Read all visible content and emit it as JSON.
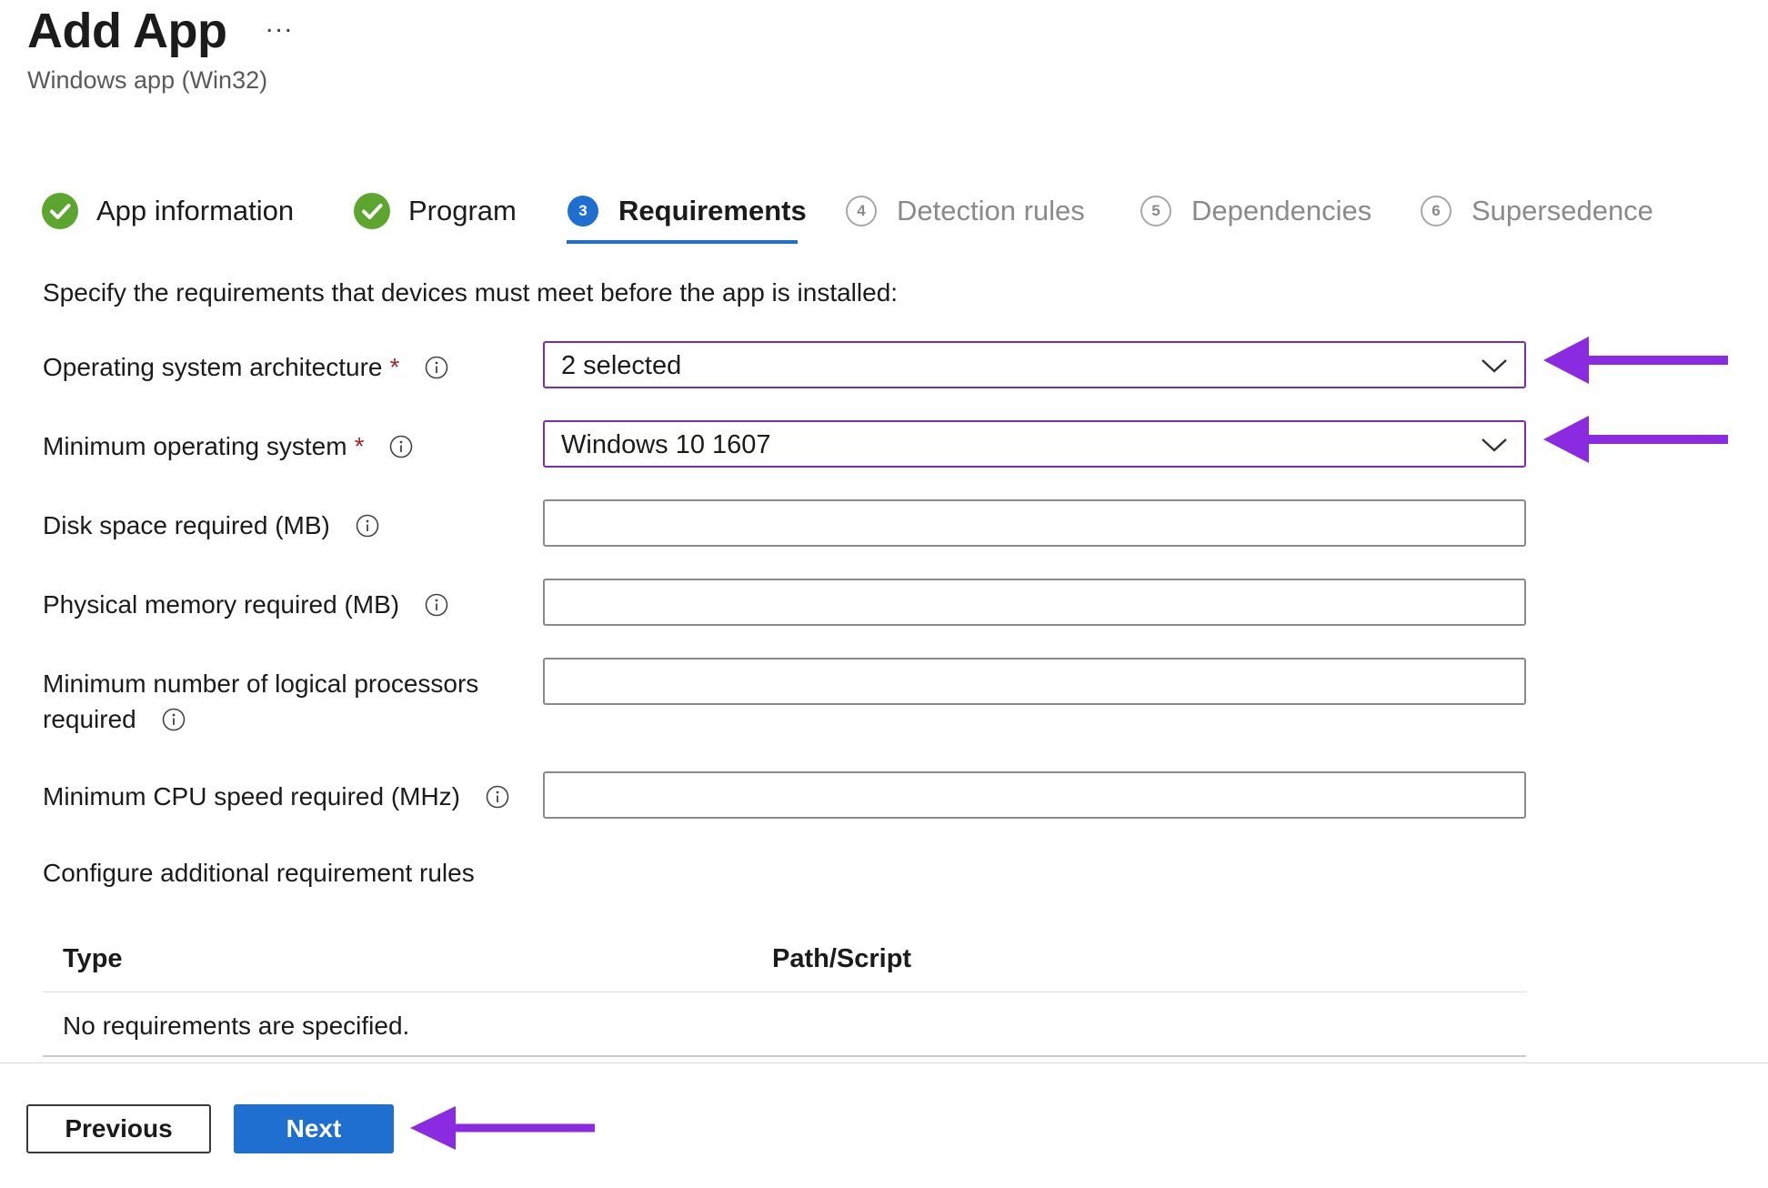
{
  "header": {
    "title": "Add App",
    "more_label": "...",
    "subtitle": "Windows app (Win32)"
  },
  "steps": [
    {
      "label": "App information",
      "state": "complete",
      "icon": "check-circle-icon"
    },
    {
      "label": "Program",
      "state": "complete",
      "icon": "check-circle-icon"
    },
    {
      "label": "Requirements",
      "state": "active",
      "number": "3"
    },
    {
      "label": "Detection rules",
      "state": "pending",
      "number": "4"
    },
    {
      "label": "Dependencies",
      "state": "pending",
      "number": "5"
    },
    {
      "label": "Supersedence",
      "state": "pending",
      "number": "6"
    }
  ],
  "instructions": "Specify the requirements that devices must meet before the app is installed:",
  "form": {
    "os_architecture": {
      "label": "Operating system architecture",
      "required_mark": "*",
      "value": "2 selected"
    },
    "min_os": {
      "label": "Minimum operating system",
      "required_mark": "*",
      "value": "Windows 10 1607"
    },
    "disk_space": {
      "label": "Disk space required (MB)",
      "value": ""
    },
    "physical_memory": {
      "label": "Physical memory required (MB)",
      "value": ""
    },
    "logical_processors": {
      "label_line1": "Minimum number of logical processors",
      "label_line2": "required",
      "value": ""
    },
    "cpu_speed": {
      "label": "Minimum CPU speed required (MHz)",
      "value": ""
    }
  },
  "additional_rules": {
    "title": "Configure additional requirement rules",
    "columns": [
      "Type",
      "Path/Script"
    ],
    "empty_message": "No requirements are specified."
  },
  "footer": {
    "previous_label": "Previous",
    "next_label": "Next"
  },
  "colors": {
    "accent": "#1e6fd0",
    "success": "#5ca52f",
    "required": "#a4262c",
    "annotation": "#8a2be2"
  }
}
